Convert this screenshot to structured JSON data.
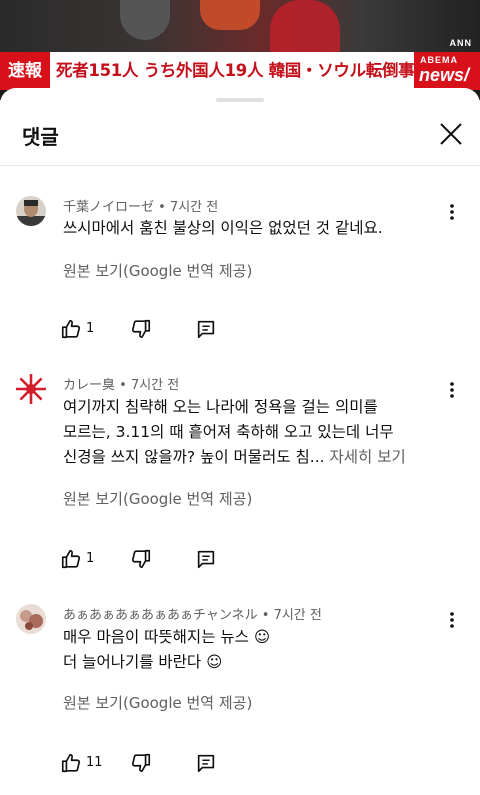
{
  "video": {
    "badge": "速報",
    "headline": "死者151人 うち外国人19人 韓国・ソウル転倒事故",
    "channel_top": "ABEMA",
    "channel_bottom": "news/",
    "agency": "ANN"
  },
  "sheet": {
    "title": "댓글"
  },
  "comments": [
    {
      "author": "千葉ノイローゼ",
      "time": "7시간 전",
      "text_lines": [
        "쓰시마에서 훔친 불상의 이익은 없었던 것 같네요."
      ],
      "more": "",
      "translate": "원본 보기(Google 번역 제공)",
      "likes": "1"
    },
    {
      "author": "カレー臭",
      "time": "7시간 전",
      "text_lines": [
        "여기까지 침략해 오는 나라에 정욕을 걸는 의미를",
        "모르는, 3.11의 때 흩어져 축하해 오고 있는데 너무",
        "신경을 쓰지 않을까? 높이 머물러도 침..."
      ],
      "more": "자세히 보기",
      "translate": "원본 보기(Google 번역 제공)",
      "likes": "1"
    },
    {
      "author": "あぁあぁあぁあぁあぁチャンネル",
      "time": "7시간 전",
      "text_lines": [
        "매우 마음이 따뜻해지는 뉴스 ☺",
        "더 늘어나기를 바란다 ☺"
      ],
      "more": "",
      "translate": "원본 보기(Google 번역 제공)",
      "likes": "11"
    }
  ],
  "colors": {
    "breaking_red": "#d8101a",
    "secondary_text": "#606060",
    "primary_text": "#0f0f0f"
  }
}
